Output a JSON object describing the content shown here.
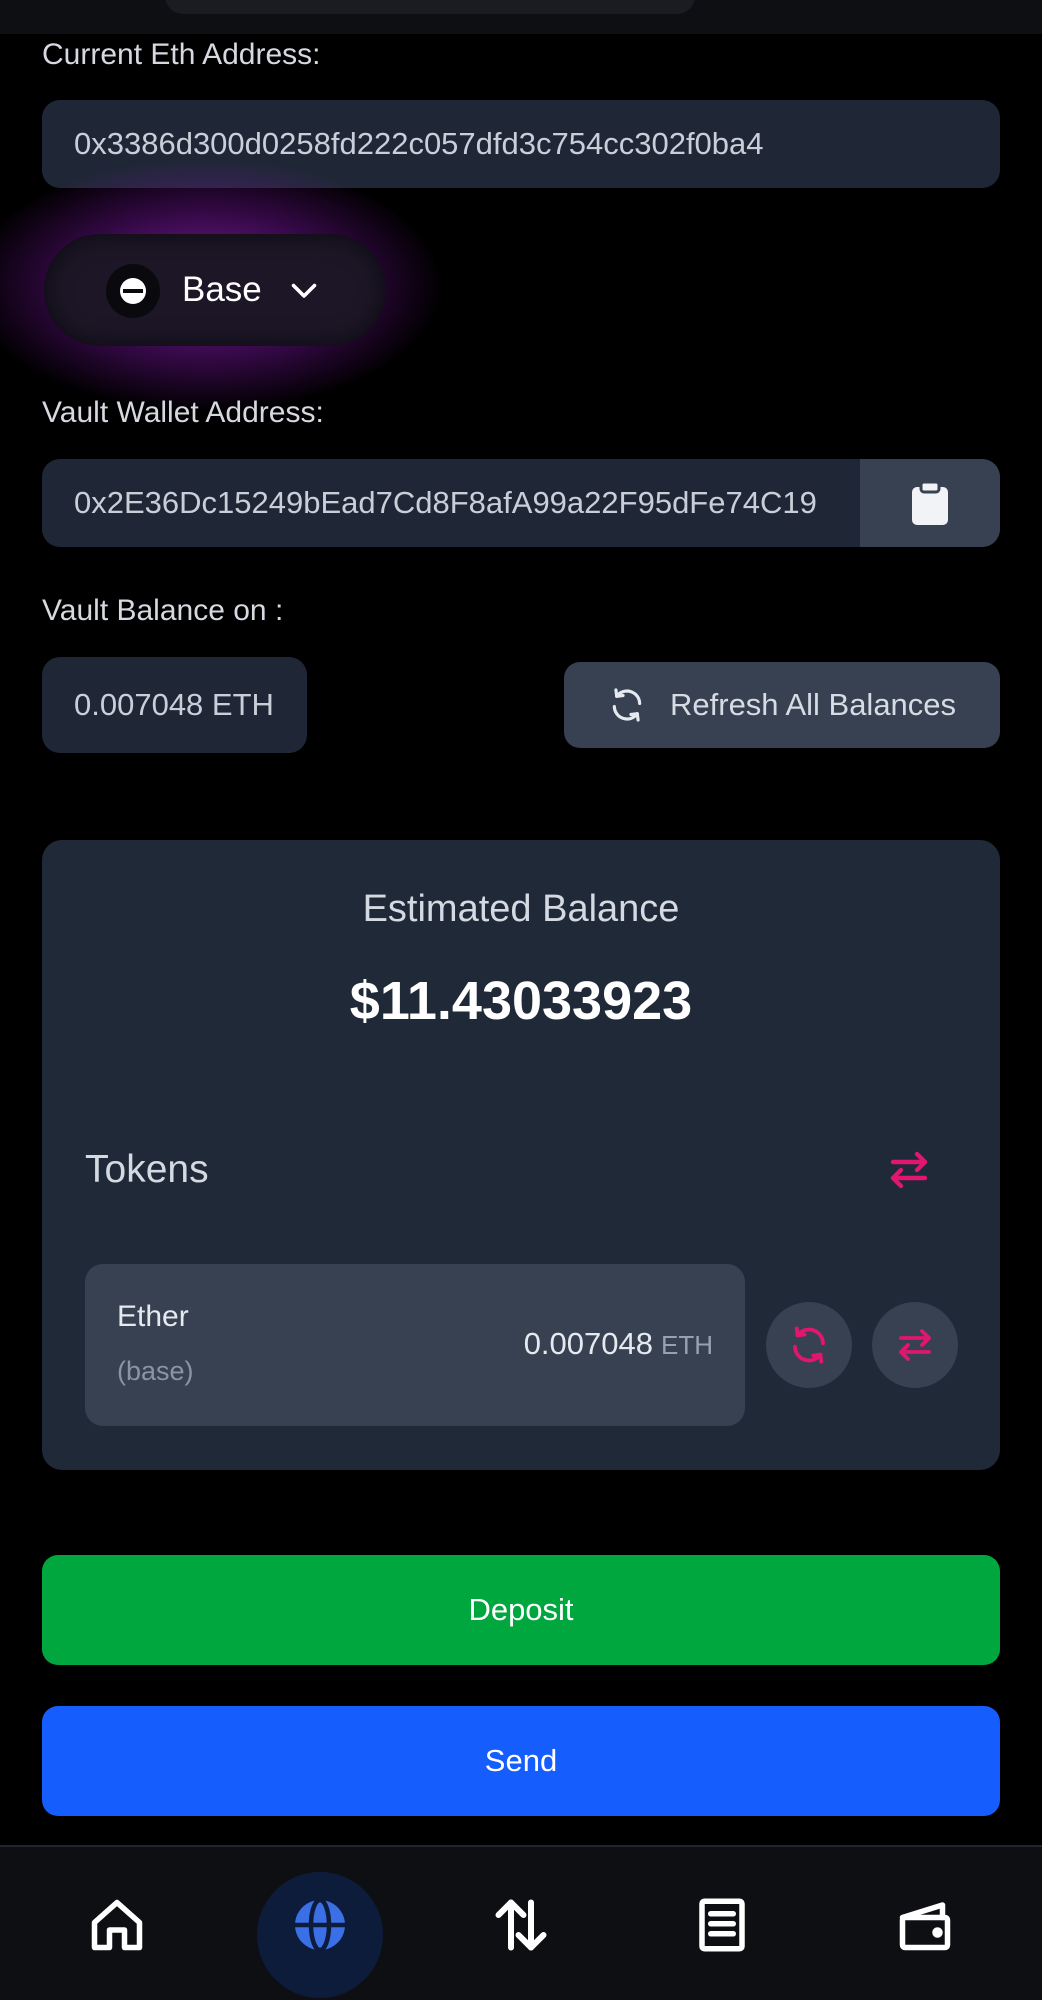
{
  "current_eth": {
    "label": "Current Eth Address:",
    "address": "0x3386d300d0258fd222c057dfd3c754cc302f0ba4"
  },
  "network": {
    "selected": "Base",
    "icon": "base-logo-icon"
  },
  "vault": {
    "label": "Vault Wallet Address:",
    "address": "0x2E36Dc15249bEad7Cd8F8afA99a22F95dFe74C19",
    "copy_icon": "clipboard-icon"
  },
  "vault_balance": {
    "label": "Vault Balance on :",
    "value": "0.007048 ETH",
    "refresh_label": "Refresh All Balances"
  },
  "estimated": {
    "title": "Estimated Balance",
    "value": "$11.43033923"
  },
  "tokens": {
    "title": "Tokens",
    "items": [
      {
        "name": "Ether",
        "chain": "(base)",
        "amount": "0.007048",
        "unit": "ETH"
      }
    ]
  },
  "actions": {
    "deposit": "Deposit",
    "send": "Send"
  },
  "bottom_nav": {
    "items": [
      "home-icon",
      "globe-icon",
      "transfer-icon",
      "document-icon",
      "wallet-icon"
    ],
    "active": "globe-icon"
  },
  "colors": {
    "background": "#000000",
    "card": "#1f2937",
    "accent_pink": "#e0166f",
    "deposit_green": "#00a63e",
    "send_blue": "#155dfc",
    "nav_active": "#3b6fe6"
  }
}
